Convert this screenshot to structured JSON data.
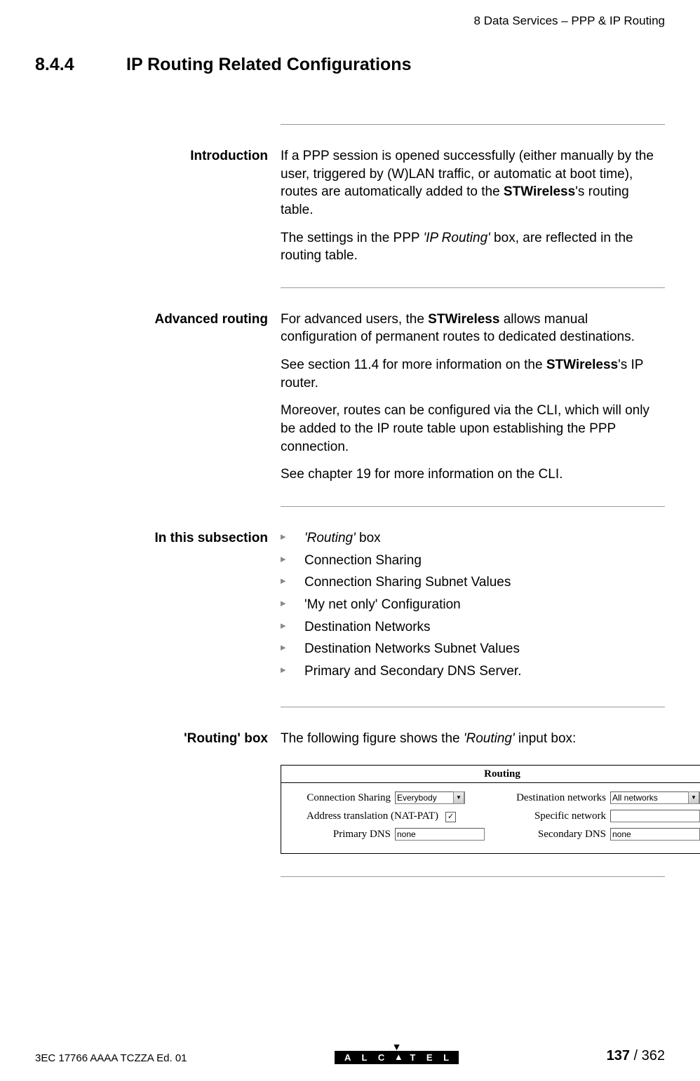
{
  "header": {
    "chapter": "8   Data Services – PPP & IP Routing"
  },
  "section": {
    "number": "8.4.4",
    "title": "IP Routing Related Configurations"
  },
  "intro": {
    "label": "Introduction",
    "p1a": "If a PPP session is opened successfully (either manually by the user, triggered by (W)LAN traffic, or automatic at boot time), routes are automatically added to the ",
    "p1b": "STWireless",
    "p1c": "'s routing table.",
    "p2a": "The settings in the PPP ",
    "p2b": "'IP Routing'",
    "p2c": " box, are reflected in the routing table."
  },
  "advanced": {
    "label": "Advanced routing",
    "p1a": "For advanced users, the ",
    "p1b": "STWireless",
    "p1c": " allows manual configuration of permanent routes to dedicated destinations.",
    "p2a": "See section 11.4 for more information on the ",
    "p2b": "STWireless",
    "p2c": "'s IP router.",
    "p3": "Moreover, routes can be configured via the CLI, which will only be added to the IP route table upon establishing the PPP connection.",
    "p4": "See chapter 19 for more information on the CLI."
  },
  "topics": {
    "label": "In this subsection",
    "items": [
      {
        "italic": "'Routing'",
        "rest": " box"
      },
      {
        "text": "Connection Sharing"
      },
      {
        "text": "Connection Sharing Subnet Values"
      },
      {
        "text": "'My net only' Configuration"
      },
      {
        "text": "Destination Networks"
      },
      {
        "text": "Destination Networks Subnet Values"
      },
      {
        "text": "Primary and Secondary DNS Server."
      }
    ]
  },
  "routingbox": {
    "label": "'Routing' box",
    "intro_a": "The following figure shows the ",
    "intro_b": "'Routing'",
    "intro_c": " input box:",
    "title": "Routing",
    "fields": {
      "conn_sharing_label": "Connection Sharing",
      "conn_sharing_value": "Everybody",
      "nat_label": "Address translation (NAT-PAT)",
      "nat_checked": true,
      "primary_dns_label": "Primary DNS",
      "primary_dns_value": "none",
      "dest_net_label": "Destination networks",
      "dest_net_value": "All networks",
      "specific_label": "Specific network",
      "specific_value": "",
      "secondary_dns_label": "Secondary DNS",
      "secondary_dns_value": "none"
    }
  },
  "footer": {
    "docid": "3EC 17766 AAAA TCZZA Ed. 01",
    "logo": "A L C A T E L",
    "page_current": "137",
    "page_total": " / 362"
  }
}
